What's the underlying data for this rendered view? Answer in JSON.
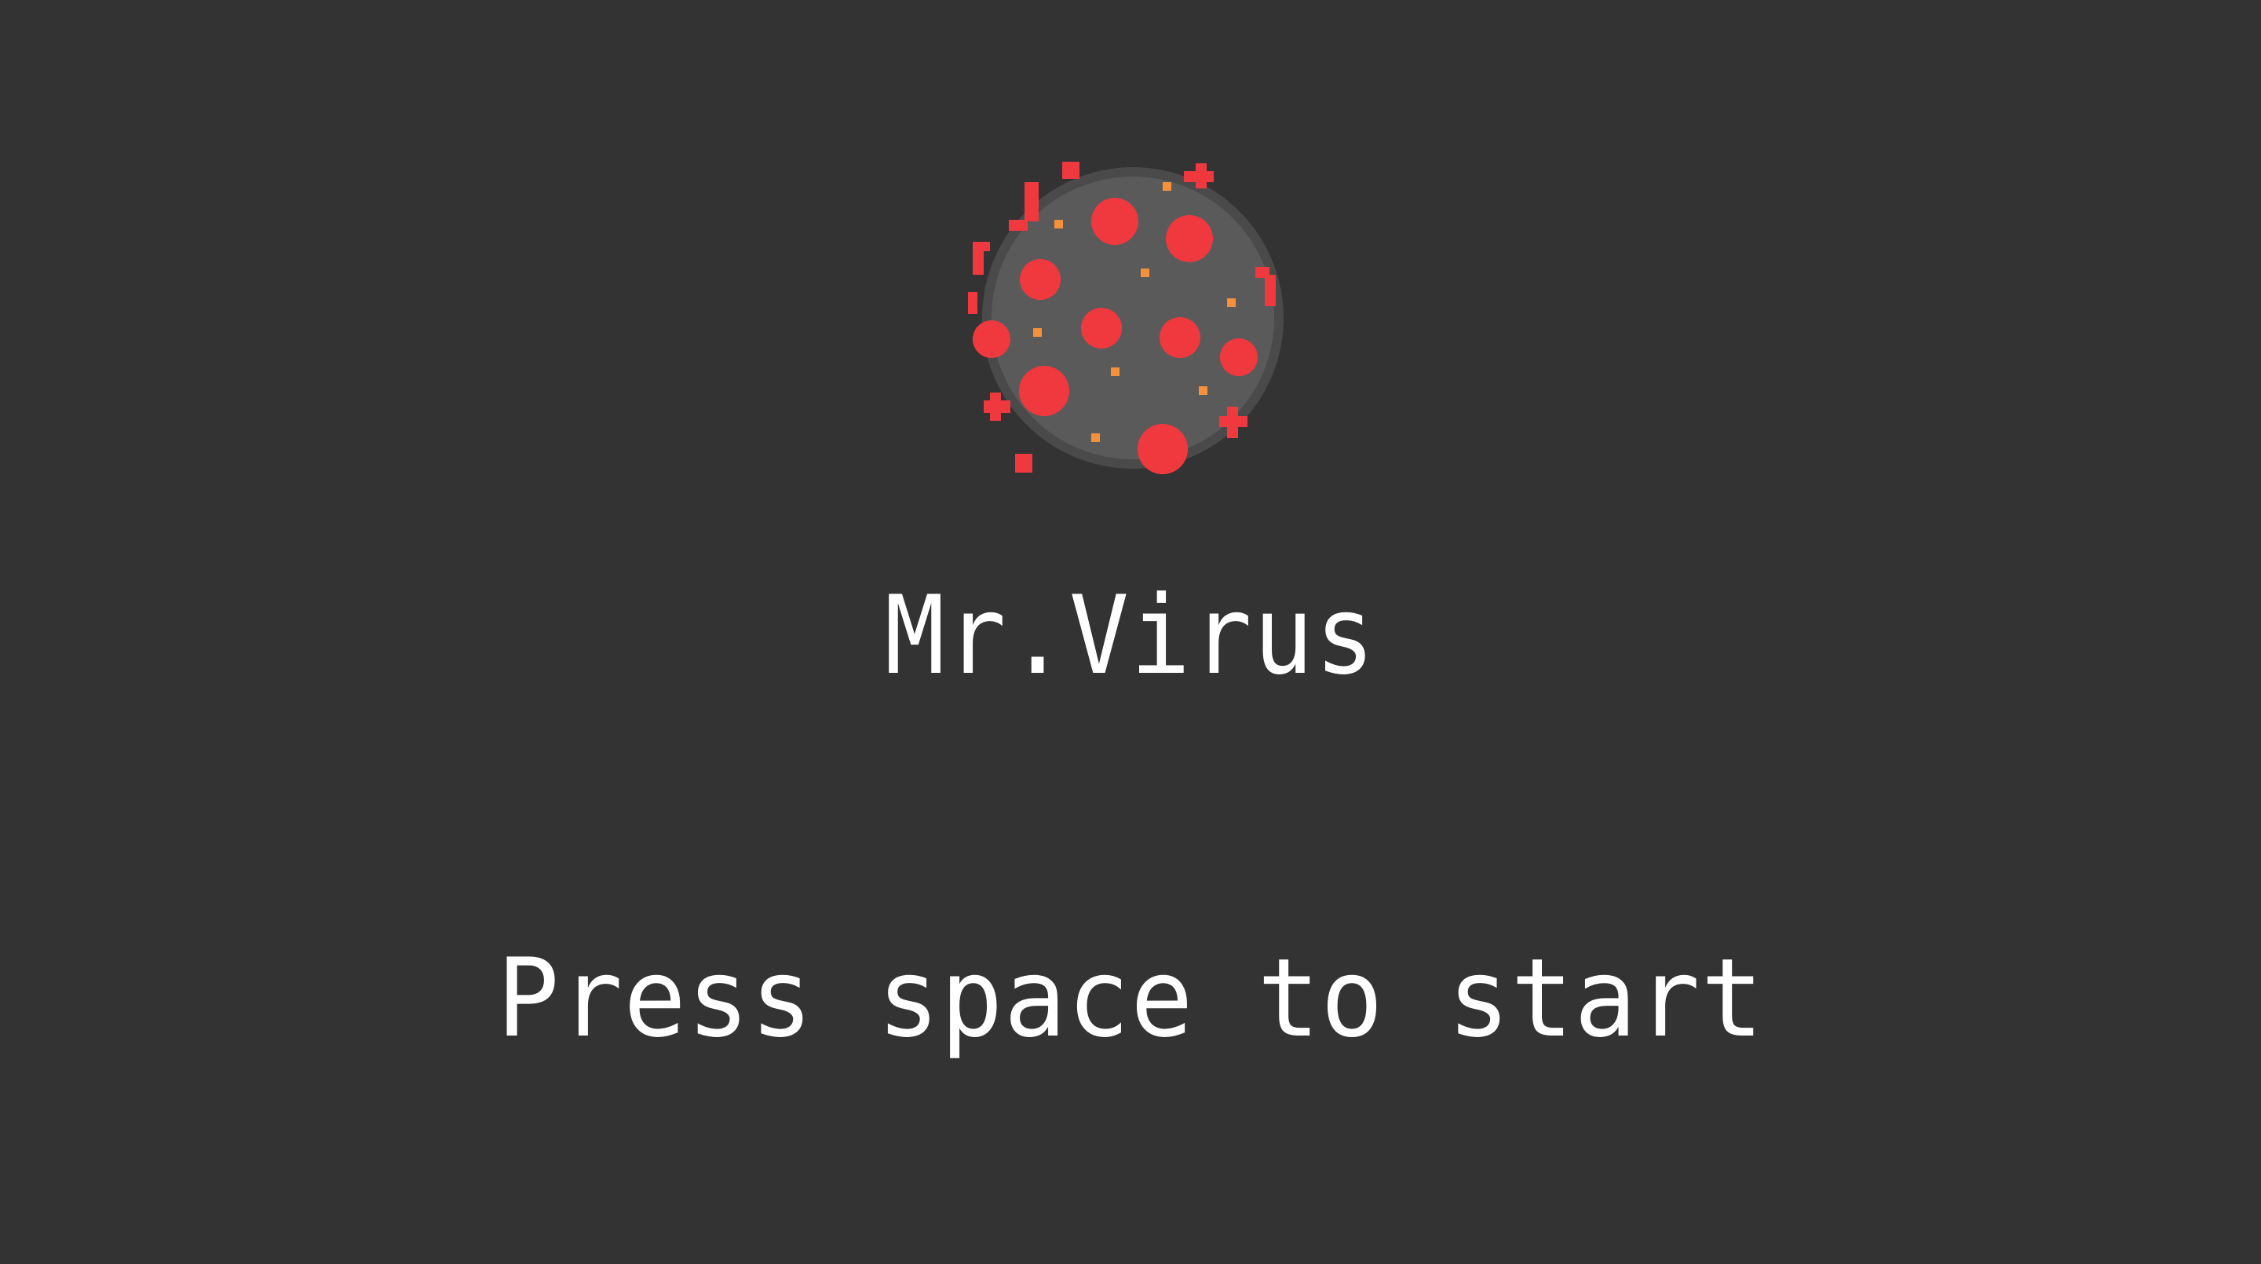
{
  "game": {
    "title": "Mr.Virus",
    "prompt": "Press space to start"
  },
  "sprite": {
    "name": "virus-icon",
    "body_color": "#5a5a5a",
    "body_shadow_color": "#4a4a4a",
    "spike_color": "#f0383f",
    "dot_color": "#f5913a"
  },
  "colors": {
    "background": "#333333",
    "text": "#ffffff"
  }
}
